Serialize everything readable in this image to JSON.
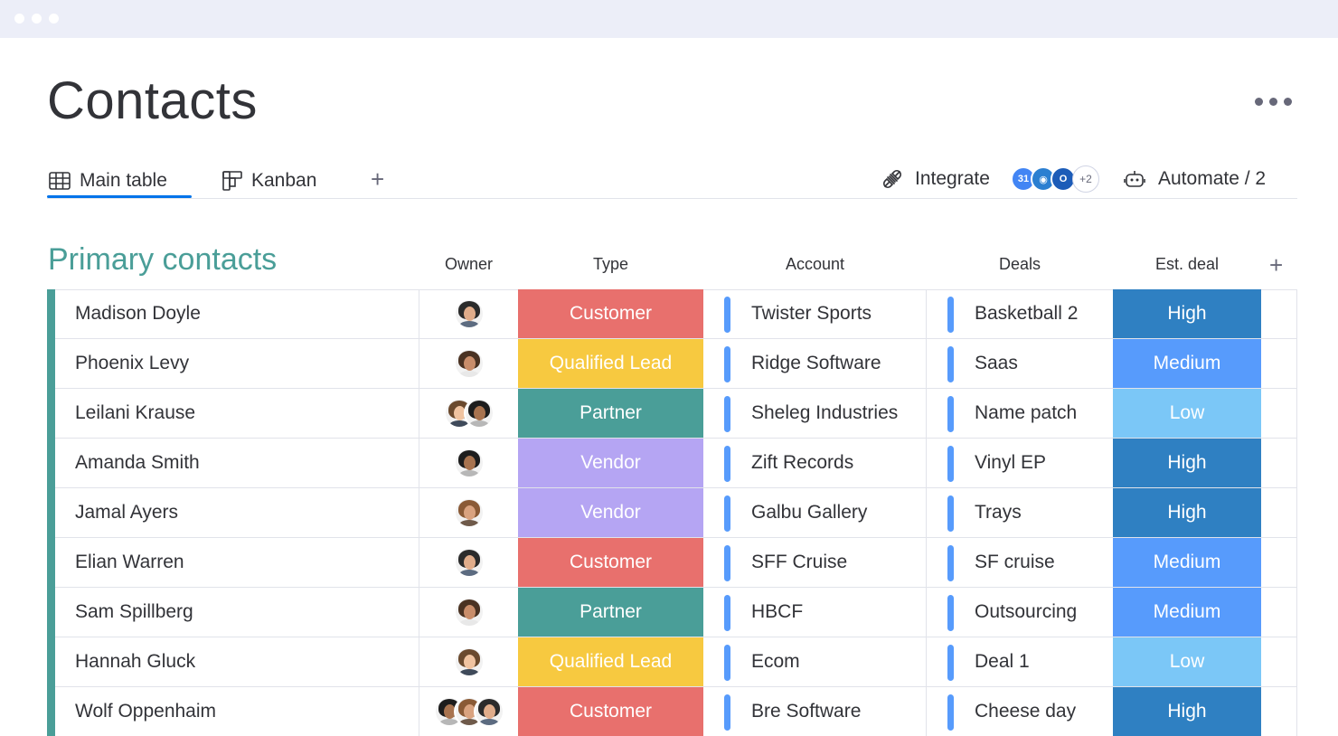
{
  "page": {
    "title": "Contacts"
  },
  "tabs": [
    {
      "label": "Main table",
      "icon": "table-icon"
    },
    {
      "label": "Kanban",
      "icon": "kanban-icon"
    }
  ],
  "toolbar": {
    "integrate_label": "Integrate",
    "integrations_more": "+2",
    "automate_label": "Automate / 2"
  },
  "group": {
    "title": "Primary contacts",
    "color": "#4a9e98"
  },
  "columns": {
    "owner": "Owner",
    "type": "Type",
    "account": "Account",
    "deals": "Deals",
    "est_deal": "Est. deal"
  },
  "type_colors": {
    "Customer": "#e8706d",
    "Qualified Lead": "#f7c940",
    "Partner": "#4a9e98",
    "Vendor": "#b5a5f3"
  },
  "est_colors": {
    "High": "#2f80c2",
    "Medium": "#579bfc",
    "Low": "#7bc7f7"
  },
  "rows": [
    {
      "name": "Madison Doyle",
      "owners": 1,
      "type": "Customer",
      "account": "Twister Sports",
      "deal": "Basketball 2",
      "est": "High"
    },
    {
      "name": "Phoenix Levy",
      "owners": 1,
      "type": "Qualified Lead",
      "account": "Ridge Software",
      "deal": "Saas",
      "est": "Medium"
    },
    {
      "name": "Leilani Krause",
      "owners": 2,
      "type": "Partner",
      "account": "Sheleg Industries",
      "deal": "Name patch",
      "est": "Low"
    },
    {
      "name": "Amanda Smith",
      "owners": 1,
      "type": "Vendor",
      "account": "Zift Records",
      "deal": "Vinyl EP",
      "est": "High"
    },
    {
      "name": "Jamal Ayers",
      "owners": 1,
      "type": "Vendor",
      "account": "Galbu Gallery",
      "deal": "Trays",
      "est": "High"
    },
    {
      "name": "Elian Warren",
      "owners": 1,
      "type": "Customer",
      "account": "SFF Cruise",
      "deal": "SF cruise",
      "est": "Medium"
    },
    {
      "name": "Sam Spillberg",
      "owners": 1,
      "type": "Partner",
      "account": "HBCF",
      "deal": "Outsourcing",
      "est": "Medium"
    },
    {
      "name": "Hannah Gluck",
      "owners": 1,
      "type": "Qualified Lead",
      "account": "Ecom",
      "deal": "Deal 1",
      "est": "Low"
    },
    {
      "name": "Wolf Oppenhaim",
      "owners": 3,
      "type": "Customer",
      "account": "Bre Software",
      "deal": "Cheese day",
      "est": "High"
    }
  ]
}
